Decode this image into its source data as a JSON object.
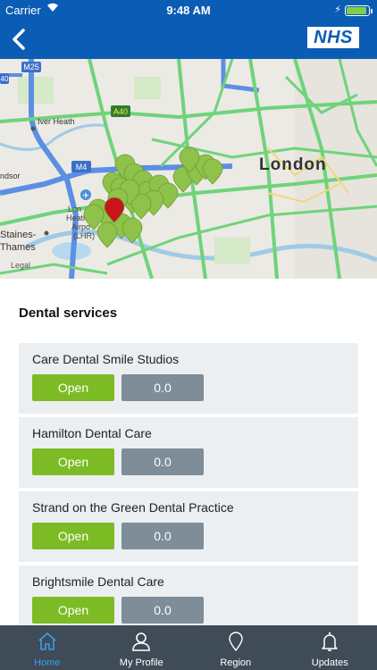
{
  "status_bar": {
    "carrier": "Carrier",
    "time": "9:48 AM"
  },
  "header": {
    "back_icon": "chevron-left-icon",
    "logo": "NHS"
  },
  "map": {
    "labels": {
      "london": "London",
      "iver_heath": "Iver Heath",
      "staines": "Staines-",
      "thames": "Thames",
      "heathrow1": "Lon",
      "heathrow2": "Heath",
      "heathrow3": "Airpo",
      "heathrow4": "(LHR)",
      "ndsor": "ndsor",
      "legal": "Legal",
      "m25": "M25",
      "m4": "M4",
      "a40": "A40",
      "m40": "40"
    },
    "pin_colors": {
      "default": "#8fc24a",
      "selected": "#c8141b"
    }
  },
  "main": {
    "title": "Dental services",
    "services": [
      {
        "name": "Care Dental Smile Studios",
        "status": "Open",
        "rating": "0.0"
      },
      {
        "name": "Hamilton Dental Care",
        "status": "Open",
        "rating": "0.0"
      },
      {
        "name": "Strand on the Green Dental Practice",
        "status": "Open",
        "rating": "0.0"
      },
      {
        "name": "Brightsmile Dental Care",
        "status": "Open",
        "rating": "0.0"
      }
    ]
  },
  "tabbar": {
    "tabs": [
      {
        "label": "Home",
        "icon": "home-icon",
        "active": true
      },
      {
        "label": "My Profile",
        "icon": "person-icon",
        "active": false
      },
      {
        "label": "Region",
        "icon": "map-pin-icon",
        "active": false
      },
      {
        "label": "Updates",
        "icon": "bell-icon",
        "active": false
      }
    ]
  },
  "colors": {
    "brand": "#0b5cb5",
    "open": "#7dbb24",
    "rating": "#7f8d99",
    "tabbar": "#3f4b57",
    "tab_active": "#3aa0e8"
  }
}
